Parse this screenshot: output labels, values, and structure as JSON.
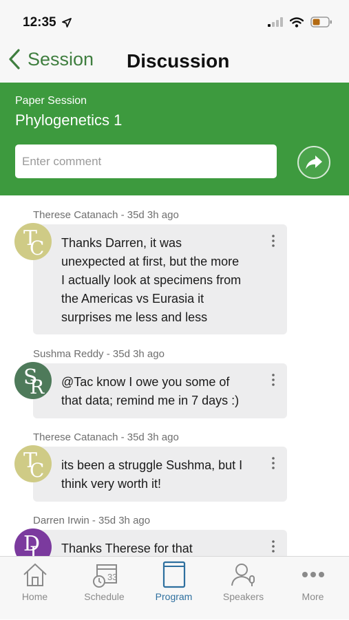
{
  "status_bar": {
    "time": "12:35"
  },
  "nav": {
    "back_label": "Session",
    "title": "Discussion"
  },
  "header": {
    "session_type": "Paper Session",
    "session_title": "Phylogenetics 1",
    "comment_placeholder": "Enter comment"
  },
  "comments": [
    {
      "author": "Therese Catanach",
      "age": "35d 3h ago",
      "meta": "Therese Catanach - 35d 3h ago",
      "initials": [
        "T",
        "C"
      ],
      "avatar_color": "#cfcb86",
      "lines": [
        "Thanks Darren, it was",
        "unexpected at first, but the more",
        "I actually look at specimens from",
        "the Americas vs Eurasia it",
        "surprises me less and less"
      ]
    },
    {
      "author": "Sushma Reddy",
      "age": "35d 3h ago",
      "meta": "Sushma Reddy - 35d 3h ago",
      "initials": [
        "S",
        "R"
      ],
      "avatar_color": "#4e7a5a",
      "lines": [
        "@Tac know I owe you some of",
        "that data; remind me in 7 days :)"
      ]
    },
    {
      "author": "Therese Catanach",
      "age": "35d 3h ago",
      "meta": "Therese Catanach - 35d 3h ago",
      "initials": [
        "T",
        "C"
      ],
      "avatar_color": "#cfcb86",
      "lines": [
        "its been a struggle Sushma, but I",
        "think very worth it!"
      ]
    },
    {
      "author": "Darren Irwin",
      "age": "35d 3h ago",
      "meta": "Darren Irwin - 35d 3h ago",
      "initials": [
        "D",
        "I"
      ],
      "avatar_color": "#7b3a9e",
      "lines": [
        "Thanks Therese for that"
      ]
    }
  ],
  "tabs": [
    {
      "label": "Home",
      "icon": "home-icon",
      "active": false
    },
    {
      "label": "Schedule",
      "icon": "calendar-clock-icon",
      "active": false
    },
    {
      "label": "Program",
      "icon": "book-icon",
      "active": true
    },
    {
      "label": "Speakers",
      "icon": "speaker-icon",
      "active": false
    },
    {
      "label": "More",
      "icon": "more-dots-icon",
      "active": false
    }
  ],
  "colors": {
    "accent_green": "#3d9a3e",
    "nav_green": "#3f7e3f",
    "active_tab": "#2d6f9e",
    "bubble": "#ededee"
  }
}
